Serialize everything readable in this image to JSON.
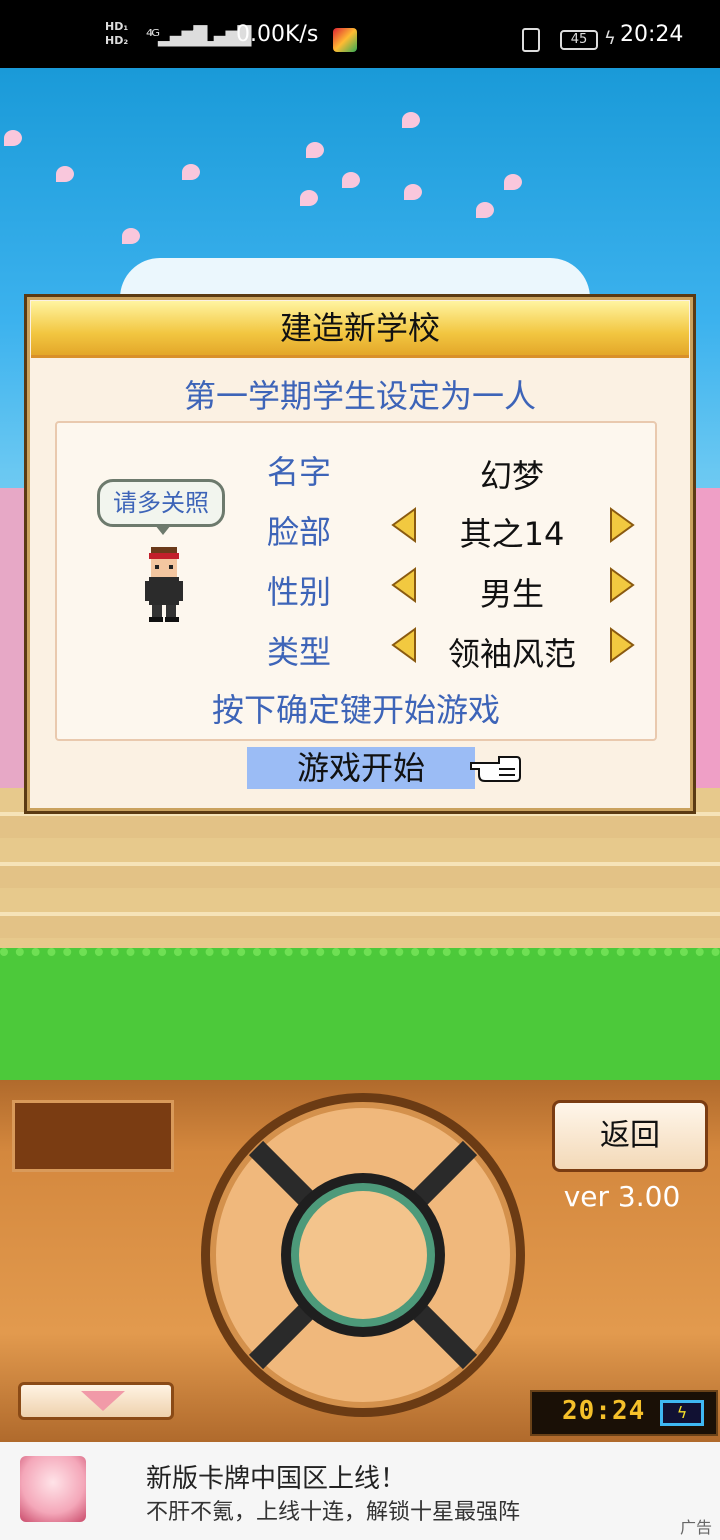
{
  "status_bar": {
    "network_speed": "0.00K/s",
    "battery": "45",
    "time": "20:24"
  },
  "dialog": {
    "title": "建造新学校",
    "subtitle": "第一学期学生设定为一人",
    "speech_bubble": "请多关照",
    "fields": [
      {
        "label": "名字",
        "value": "幻梦"
      },
      {
        "label": "脸部",
        "value": "其之14"
      },
      {
        "label": "性别",
        "value": "男生"
      },
      {
        "label": "类型",
        "value": "领袖风范"
      }
    ],
    "hint": "按下确定键开始游戏",
    "start_label": "游戏开始"
  },
  "controller": {
    "back_label": "返回",
    "version": "ver 3.00",
    "clock": "20:24"
  },
  "ad": {
    "title": "新版卡牌中国区上线！",
    "subtitle": "不肝不氪，上线十连，解锁十星最强阵",
    "label": "广告"
  }
}
